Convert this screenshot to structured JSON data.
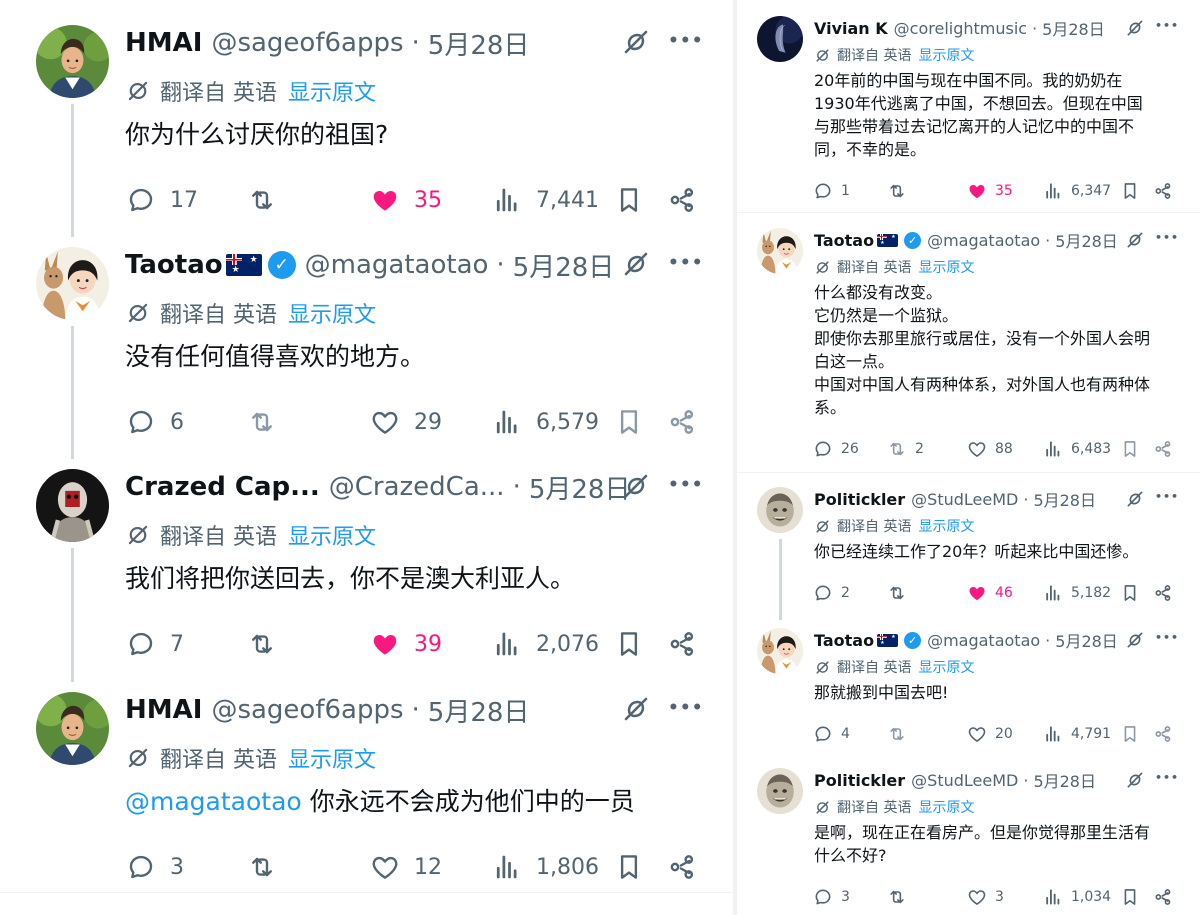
{
  "translate": {
    "label": "翻译自 英语",
    "show_original": "显示原文"
  },
  "left_thread": [
    {
      "name": "HMAI",
      "handle": "@sageof6apps",
      "sep": "·",
      "date": "5月28日",
      "lines": [
        "你为什么讨厌你的祖国?"
      ],
      "stats": {
        "replies": "17",
        "retweets": "",
        "likes": "35",
        "views": "7,441"
      },
      "liked": true,
      "avatar": "hmai"
    },
    {
      "name": "Taotao",
      "handle": "@magataotao",
      "sep": "·",
      "date": "5月28日",
      "lines": [
        "没有任何值得喜欢的地方。"
      ],
      "stats": {
        "replies": "6",
        "retweets": "",
        "likes": "29",
        "views": "6,579"
      },
      "liked": false,
      "avatar": "taotao",
      "flag": true,
      "verified": true,
      "muted": true
    },
    {
      "name": "Crazed Cap...",
      "handle": "@CrazedCa...",
      "sep": "·",
      "date": "5月28日",
      "lines": [
        "我们将把你送回去，你不是澳大利亚人。"
      ],
      "stats": {
        "replies": "7",
        "retweets": "",
        "likes": "39",
        "views": "2,076"
      },
      "liked": true,
      "avatar": "crazed"
    },
    {
      "name": "HMAI",
      "handle": "@sageof6apps",
      "sep": "·",
      "date": "5月28日",
      "mention": "@magataotao",
      "lines": [
        "你永远不会成为他们中的一员"
      ],
      "stats": {
        "replies": "3",
        "retweets": "",
        "likes": "12",
        "views": "1,806"
      },
      "liked": false,
      "avatar": "hmai"
    }
  ],
  "right_thread": [
    {
      "name": "Vivian K",
      "handle": "@corelightmusic",
      "sep": "·",
      "date": "5月28日",
      "lines": [
        "20年前的中国与现在中国不同。我的奶奶在",
        "1930年代逃离了中国，不想回去。但现在中国",
        "与那些带着过去记忆离开的人记忆中的中国不",
        "同，不幸的是。"
      ],
      "stats": {
        "replies": "1",
        "retweets": "",
        "likes": "35",
        "views": "6,347"
      },
      "liked": true,
      "avatar": "vivian"
    },
    {
      "name": "Taotao",
      "handle": "@magataotao",
      "sep": "·",
      "date": "5月28日",
      "lines": [
        "什么都没有改变。",
        "它仍然是一个监狱。",
        "即使你去那里旅行或居住，没有一个外国人会明",
        "白这一点。",
        "中国对中国人有两种体系，对外国人也有两种体",
        "系。"
      ],
      "stats": {
        "replies": "26",
        "retweets": "2",
        "likes": "88",
        "views": "6,483"
      },
      "liked": false,
      "avatar": "taotao",
      "flag": true,
      "verified": true,
      "muted": true
    },
    {
      "name": "Politickler",
      "handle": "@StudLeeMD",
      "sep": "·",
      "date": "5月28日",
      "lines": [
        "你已经连续工作了20年？听起来比中国还惨。"
      ],
      "stats": {
        "replies": "2",
        "retweets": "",
        "likes": "46",
        "views": "5,182"
      },
      "liked": true,
      "avatar": "politickler"
    },
    {
      "name": "Taotao",
      "handle": "@magataotao",
      "sep": "·",
      "date": "5月28日",
      "lines": [
        "那就搬到中国去吧!"
      ],
      "stats": {
        "replies": "4",
        "retweets": "",
        "likes": "20",
        "views": "4,791"
      },
      "liked": false,
      "avatar": "taotao",
      "flag": true,
      "verified": true,
      "muted": true
    },
    {
      "name": "Politickler",
      "handle": "@StudLeeMD",
      "sep": "·",
      "date": "5月28日",
      "lines": [
        "是啊，现在正在看房产。但是你觉得那里生活有",
        "什么不好?"
      ],
      "stats": {
        "replies": "3",
        "retweets": "",
        "likes": "3",
        "views": "1,034"
      },
      "liked": false,
      "avatar": "politickler"
    }
  ],
  "colors": {
    "text": "#0f1419",
    "muted": "#536471",
    "accent": "#1d9bf0",
    "like": "#f91880",
    "line": "#cfd9de"
  },
  "icons": {
    "translate": "translate-icon",
    "grok": "grok-slash-icon",
    "more": "more-icon",
    "reply": "reply-icon",
    "retweet": "retweet-icon",
    "like": "heart-icon",
    "views": "views-icon",
    "bookmark": "bookmark-icon",
    "share": "share-icon"
  }
}
